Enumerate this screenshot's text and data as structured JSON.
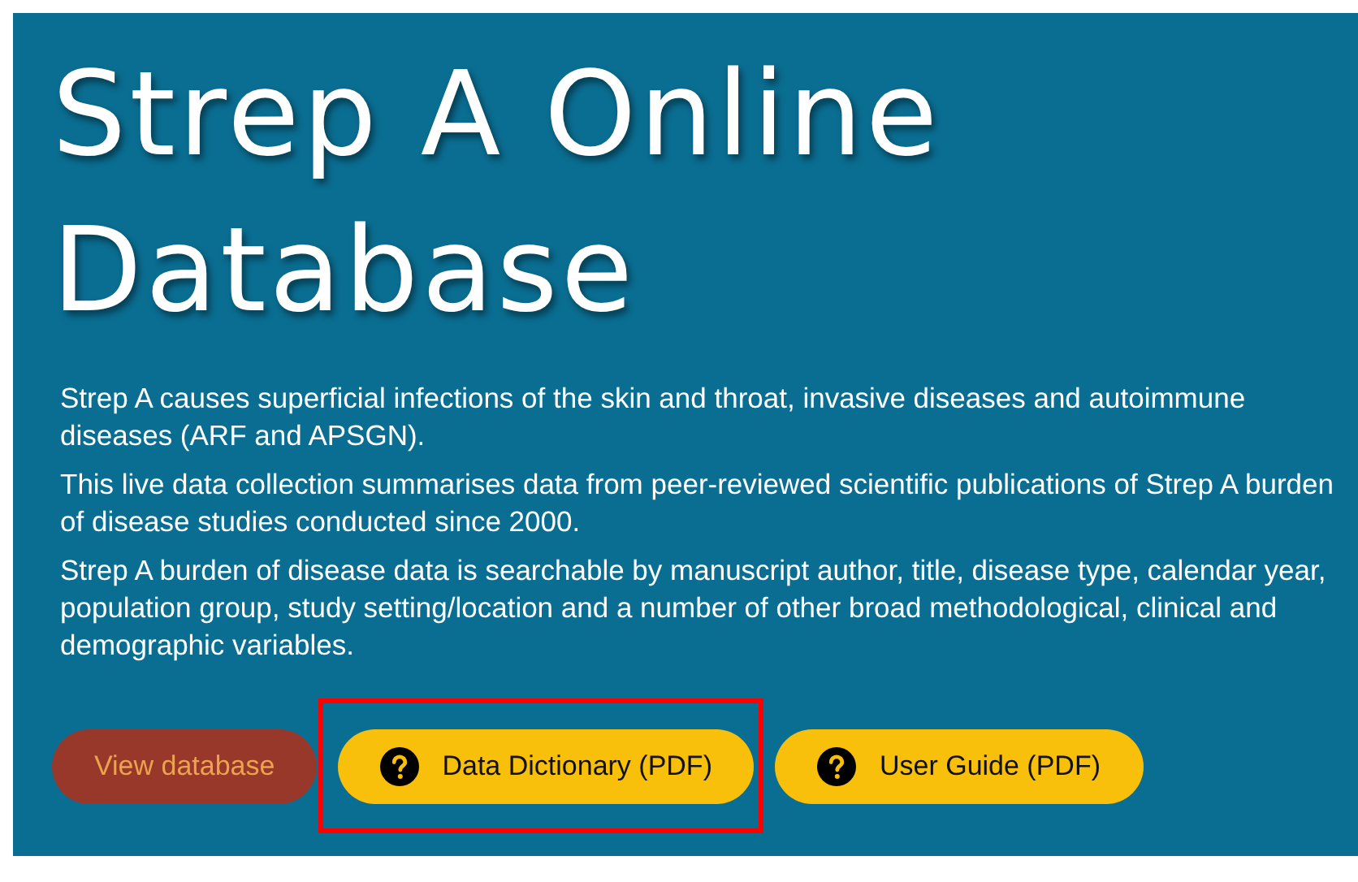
{
  "title_lines": [
    "Strep A Online",
    "Database"
  ],
  "paragraphs": [
    "Strep A causes superficial infections of the skin and throat, invasive diseases and autoimmune diseases (ARF and APSGN).",
    "This live data collection summarises data from peer-reviewed scientific publications of Strep A burden of disease studies conducted since 2000.",
    "Strep A burden of disease data is searchable by manuscript author, title, disease type, calendar year, population group, study setting/location and a number of other broad methodological, clinical and demographic variables."
  ],
  "buttons": [
    {
      "label": "View database",
      "kind": "primary",
      "highlighted": false
    },
    {
      "label": "Data Dictionary (PDF)",
      "kind": "help",
      "highlighted": true
    },
    {
      "label": "User Guide (PDF)",
      "kind": "help",
      "highlighted": false
    }
  ]
}
